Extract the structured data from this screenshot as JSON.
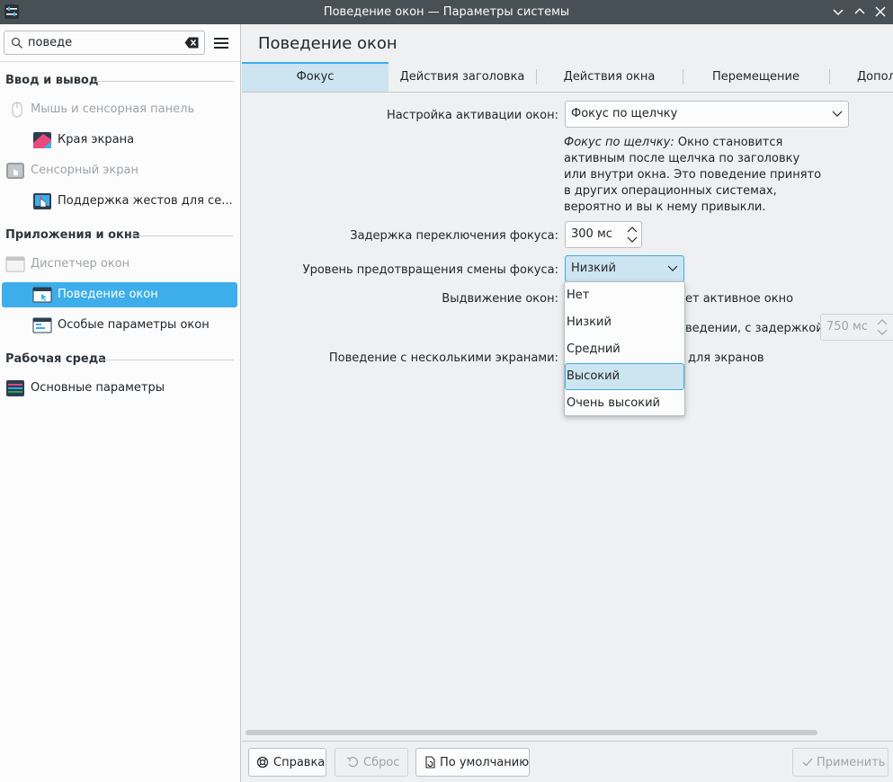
{
  "window": {
    "title": "Поведение окон — Параметры системы"
  },
  "sidebar": {
    "search_value": "поведе",
    "sections": [
      {
        "label": "Ввод и вывод",
        "items": [
          {
            "label": "Мышь и сенсорная панель",
            "icon": "mouse-icon",
            "disabled": true
          },
          {
            "label": "Края экрана",
            "icon": "screen-edges-icon",
            "disabled": false
          },
          {
            "label": "Сенсорный экран",
            "icon": "touchscreen-icon",
            "disabled": true
          },
          {
            "label": "Поддержка жестов для се...",
            "icon": "gesture-icon",
            "disabled": false
          }
        ]
      },
      {
        "label": "Приложения и окна",
        "items": [
          {
            "label": "Диспетчер окон",
            "icon": "window-manager-icon",
            "disabled": true
          },
          {
            "label": "Поведение окон",
            "icon": "window-behavior-icon",
            "selected": true
          },
          {
            "label": "Особые параметры окон",
            "icon": "window-rules-icon",
            "disabled": false
          }
        ]
      },
      {
        "label": "Рабочая среда",
        "items": [
          {
            "label": "Основные параметры",
            "icon": "settings-icon",
            "disabled": false
          }
        ]
      }
    ]
  },
  "main": {
    "title": "Поведение окон",
    "tabs": [
      "Фокус",
      "Действия заголовка",
      "Действия окна",
      "Перемещение",
      "Допол"
    ],
    "active_tab": 0,
    "focus": {
      "activation_label": "Настройка активации окон:",
      "activation_value": "Фокус по щелчку",
      "desc_italic": "Фокус по щелчку:",
      "desc_text": " Окно становится активным после щелчка по заголовку или внутри окна. Это поведение принято в других операционных системах, вероятно и вы к нему привыкли.",
      "delay_label": "Задержка переключения фокуса:",
      "delay_value": "300 мс",
      "prevention_label": "Уровень предотвращения смены фокуса:",
      "prevention_value": "Низкий",
      "raise_label": "Выдвижение окон:",
      "raise_partial": "ет активное окно",
      "raise2_partial": "ведении, с задержкой:",
      "raise2_value": "750 мс",
      "multiscreen_label": "Поведение с несколькими экранами:",
      "multiscreen_partial": "для экранов"
    },
    "dropdown_options": [
      "Нет",
      "Низкий",
      "Средний",
      "Высокий",
      "Очень высокий"
    ],
    "dropdown_highlight": 3
  },
  "buttons": {
    "help": "Справка",
    "reset": "Сброс",
    "defaults": "По умолчанию",
    "apply": "Применить"
  },
  "colors": {
    "accent": "#3daee9",
    "titlebar": "#475057",
    "highlight": "#cde4f1"
  }
}
